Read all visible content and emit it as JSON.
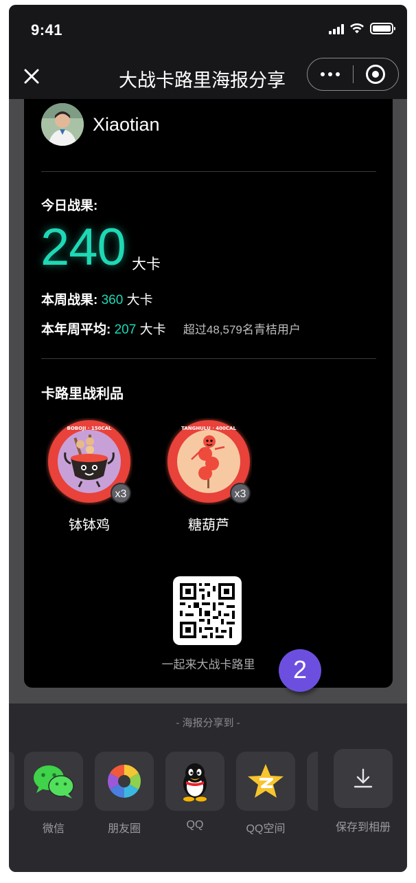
{
  "status_bar": {
    "time": "9:41"
  },
  "nav": {
    "title": "大战卡路里海报分享"
  },
  "poster": {
    "user_name": "Xiaotian",
    "today_label": "今日战果:",
    "today_value": "240",
    "today_unit": "大卡",
    "week_label": "本周战果:",
    "week_value": "360",
    "week_unit": "大卡",
    "year_label": "本年周平均:",
    "year_value": "207",
    "year_unit": "大卡",
    "year_note": "超过48,579名青桔用户",
    "trophies_title": "卡路里战利品",
    "trophies": [
      {
        "name": "钵钵鸡",
        "count": "x3",
        "ring_text": "BOBOJI"
      },
      {
        "name": "糖葫芦",
        "count": "x3",
        "ring_text": "TANGHULU"
      }
    ],
    "qr_caption": "一起来大战卡路里",
    "step_number": "2"
  },
  "share": {
    "title": "- 海报分享到 -",
    "targets": [
      {
        "label": "微信",
        "icon": "wechat-icon"
      },
      {
        "label": "朋友圈",
        "icon": "moments-icon"
      },
      {
        "label": "QQ",
        "icon": "qq-icon"
      },
      {
        "label": "QQ空间",
        "icon": "qzone-icon"
      },
      {
        "label": "保存到相册",
        "icon": "download-icon"
      }
    ]
  },
  "colors": {
    "accent_teal": "#1fd8b5",
    "step_purple": "#6d4fe0",
    "badge_red": "#e8423a"
  }
}
